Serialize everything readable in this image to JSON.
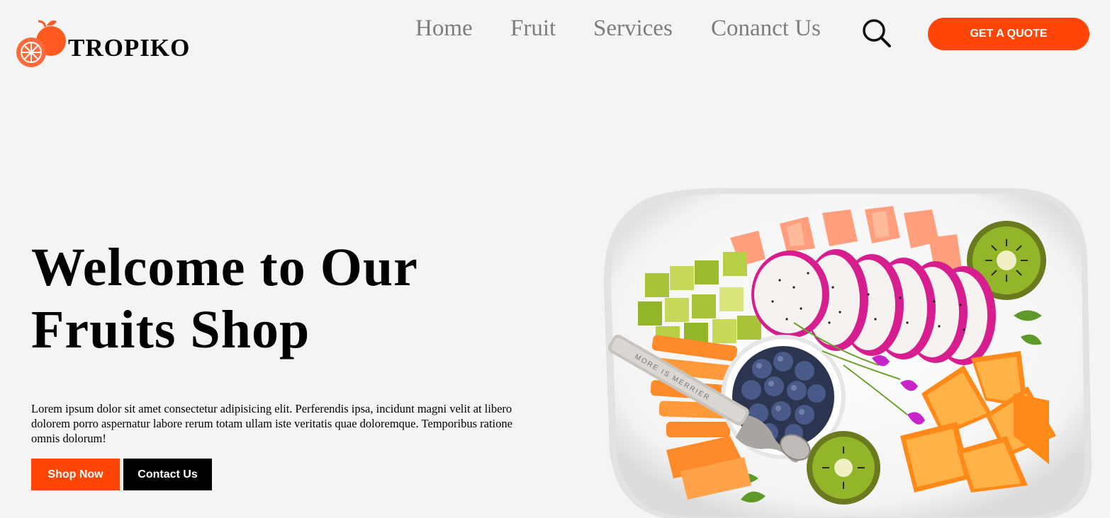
{
  "header": {
    "logo_text": "TROPIKO",
    "nav": [
      {
        "label": "Home"
      },
      {
        "label": "Fruit"
      },
      {
        "label": "Services"
      },
      {
        "label": "Conanct Us"
      }
    ],
    "search_icon": "search-icon",
    "quote_button": "GET A QUOTE"
  },
  "hero": {
    "title_line1": "Welcome to Our",
    "title_line2": "Fruits Shop",
    "description": "Lorem ipsum dolor sit amet consectetur adipisicing elit. Perferendis ipsa, incidunt magni velit at libero dolorem porro aspernatur labore rerum totam ullam iste veritatis quae doloremque. Temporibus ratione omnis dolorum!",
    "shop_button": "Shop Now",
    "contact_button": "Contact Us",
    "spoon_engraving": "MORE IS MERRIER"
  },
  "colors": {
    "accent": "#ff4508",
    "background": "#f4f4f4",
    "nav_text": "#7d7d7d",
    "dark": "#000000"
  }
}
